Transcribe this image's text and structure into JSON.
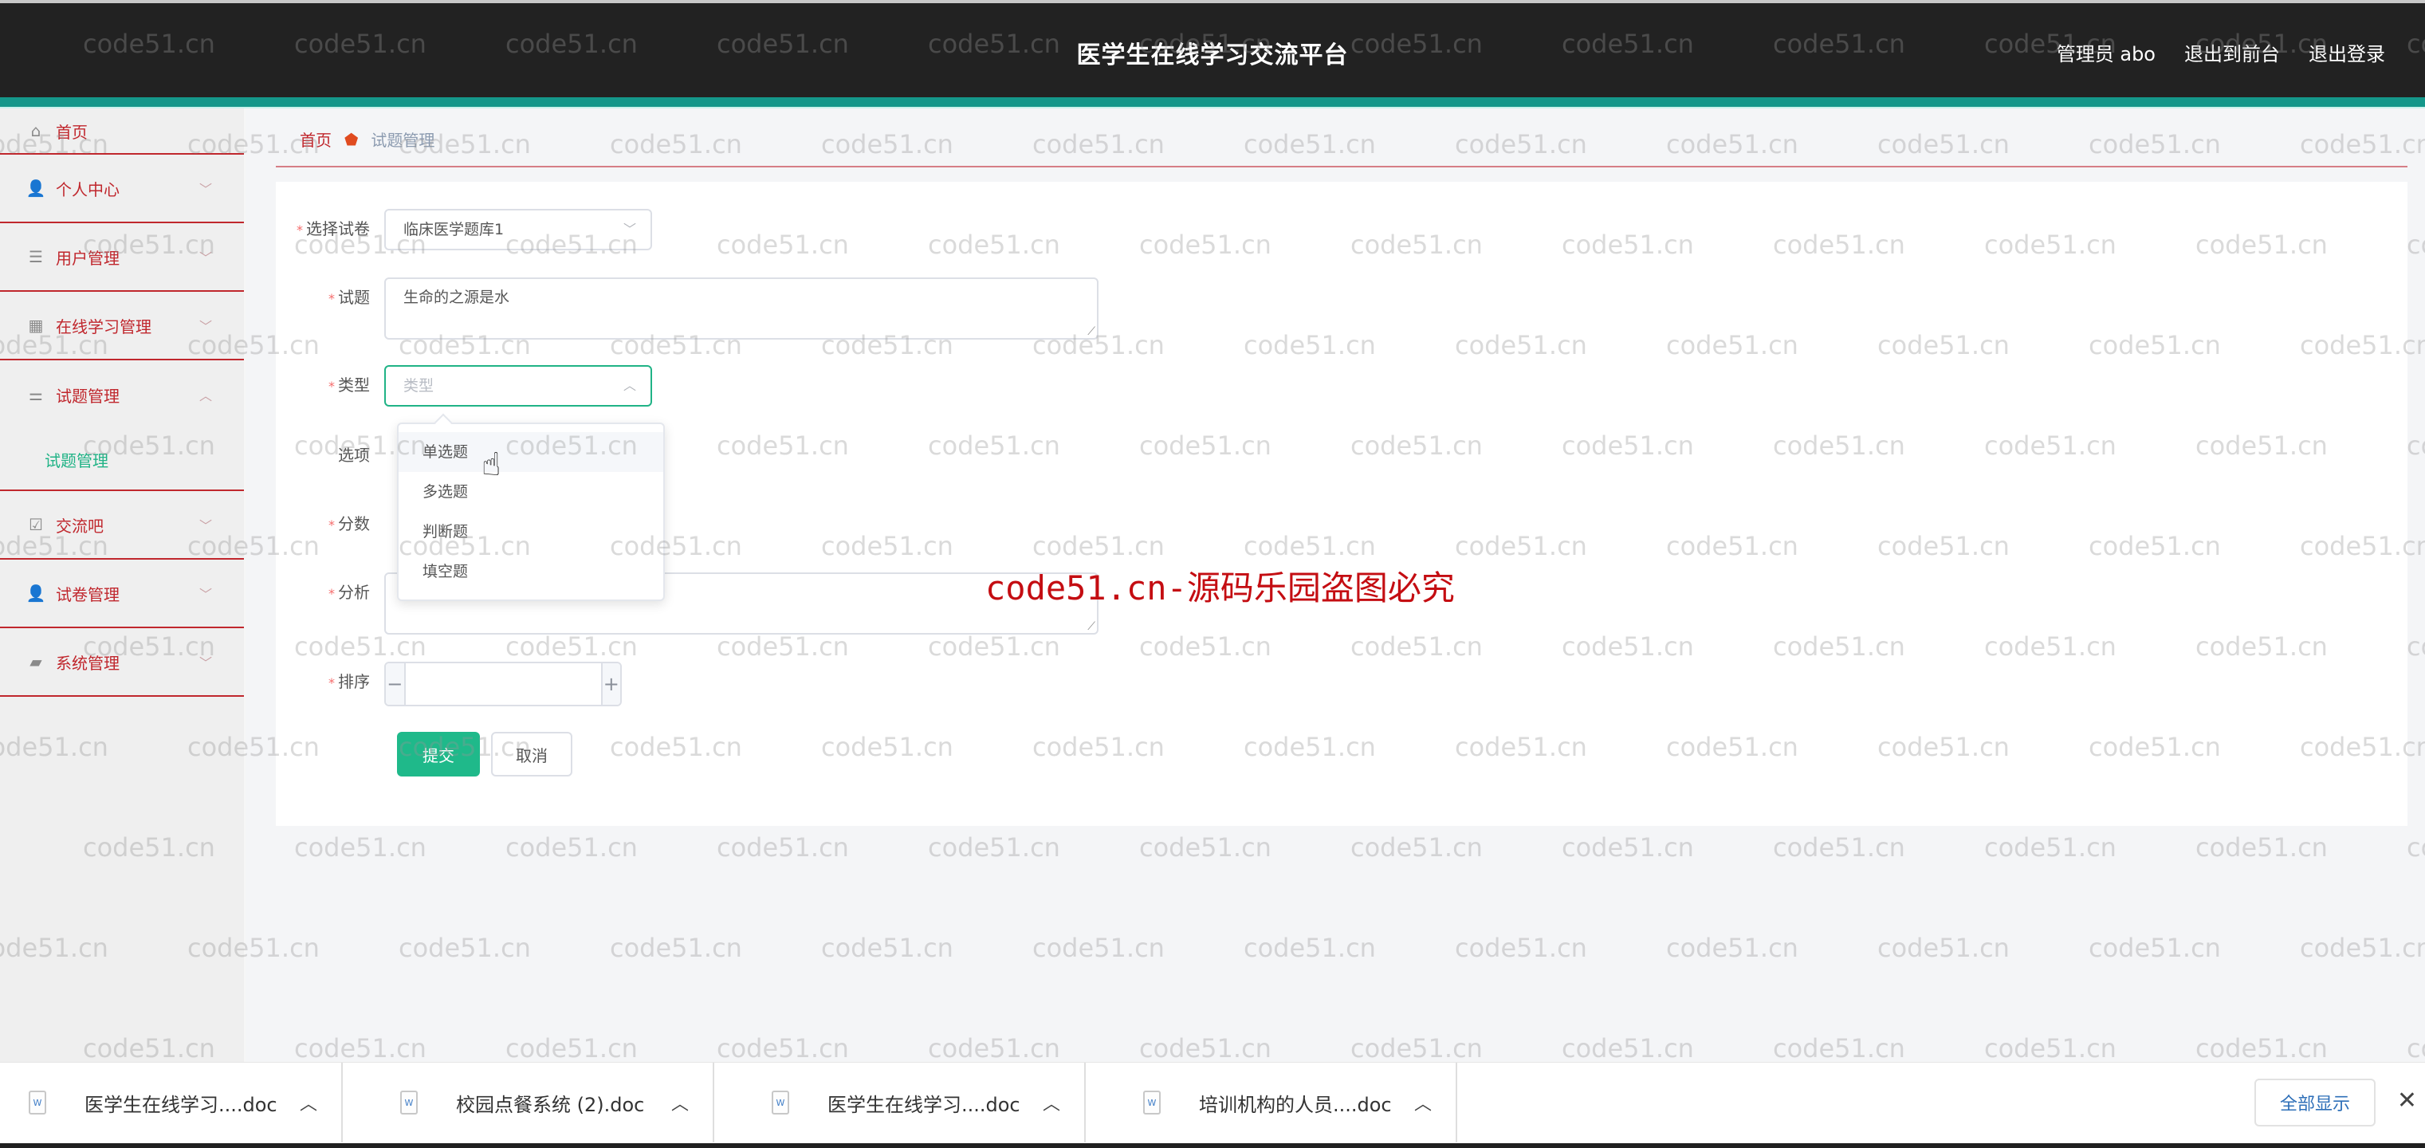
{
  "header": {
    "title": "医学生在线学习交流平台",
    "user_label": "管理员 abo",
    "to_frontend": "退出到前台",
    "logout": "退出登录"
  },
  "sidebar": {
    "items": [
      {
        "label": "首页",
        "icon": "home-icon"
      },
      {
        "label": "个人中心",
        "icon": "user-icon"
      },
      {
        "label": "用户管理",
        "icon": "list-icon"
      },
      {
        "label": "在线学习管理",
        "icon": "grid-icon"
      },
      {
        "label": "试题管理",
        "icon": "sliders-icon",
        "expanded": true,
        "children": [
          {
            "label": "试题管理",
            "active": true
          }
        ]
      },
      {
        "label": "交流吧",
        "icon": "clipboard-check-icon"
      },
      {
        "label": "试卷管理",
        "icon": "user-tie-icon"
      },
      {
        "label": "系统管理",
        "icon": "wallet-icon"
      }
    ]
  },
  "breadcrumb": {
    "home": "首页",
    "current": "试题管理"
  },
  "form": {
    "paper": {
      "label": "选择试卷",
      "value": "临床医学题库1",
      "required": true
    },
    "question": {
      "label": "试题",
      "value": "生命的之源是水",
      "required": true
    },
    "type": {
      "label": "类型",
      "placeholder": "类型",
      "required": true,
      "open": true
    },
    "options": {
      "label": "选项"
    },
    "score": {
      "label": "分数",
      "required": true
    },
    "analysis": {
      "label": "分析",
      "required": true,
      "value": ""
    },
    "order": {
      "label": "排序",
      "required": true,
      "value": "",
      "minus": "−",
      "plus": "+"
    },
    "submit_label": "提交",
    "cancel_label": "取消"
  },
  "type_dropdown": {
    "options": [
      "单选题",
      "多选题",
      "判断题",
      "填空题"
    ],
    "hovered_index": 0
  },
  "watermark": {
    "banner": "code51.cn-源码乐园盗图必究",
    "tile": "code51.cn"
  },
  "downloads": {
    "items": [
      {
        "name": "医学生在线学习....doc"
      },
      {
        "name": "校园点餐系统 (2).doc"
      },
      {
        "name": "医学生在线学习....doc"
      },
      {
        "name": "培训机构的人员....doc"
      }
    ],
    "show_all": "全部显示",
    "close": "✕"
  },
  "colors": {
    "accent_green": "#1fb98a",
    "header_bg": "#222222",
    "header_accent": "#14978a",
    "menu_red": "#c0272d"
  }
}
